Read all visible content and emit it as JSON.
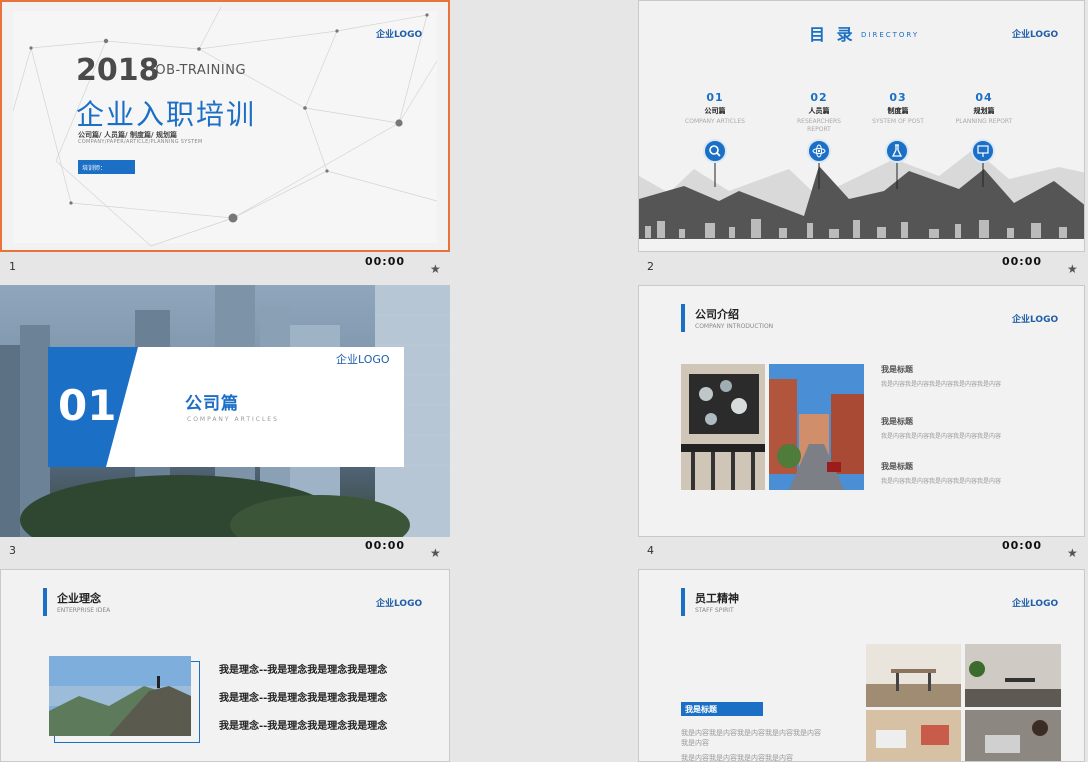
{
  "slides": [
    {
      "number": "1",
      "time": "00:00",
      "logo": "企业LOGO",
      "year": "2018",
      "job_training": "JOB-TRAINING",
      "title": "企业入职培训",
      "subtitle": "公司篇/ 人员篇/ 制度篇/ 规划篇",
      "subtitle_en": "COMPANY/PAPER/ARTICLE/PLANNING SYSTEM",
      "trainer": "培训师："
    },
    {
      "number": "2",
      "time": "00:00",
      "logo": "企业LOGO",
      "title": "目 录",
      "title_en": "DIRECTORY",
      "items": [
        {
          "num": "01",
          "label": "公司篇",
          "en": "COMPANY ARTICLES",
          "icon": "search-icon"
        },
        {
          "num": "02",
          "label": "人员篇",
          "en": "RESEARCHERS REPORT",
          "icon": "atom-icon"
        },
        {
          "num": "03",
          "label": "制度篇",
          "en": "SYSTEM OF POST",
          "icon": "flask-icon"
        },
        {
          "num": "04",
          "label": "规划篇",
          "en": "PLANNING REPORT",
          "icon": "presentation-icon"
        }
      ]
    },
    {
      "number": "3",
      "time": "00:00",
      "logo": "企业LOGO",
      "section_num": "01",
      "title": "公司篇",
      "title_en": "COMPANY ARTICLES"
    },
    {
      "number": "4",
      "time": "00:00",
      "logo": "企业LOGO",
      "title": "公司介绍",
      "title_en": "COMPANY INTRODUCTION",
      "blocks": [
        {
          "heading": "我是标题",
          "text": "我是内容我是内容我是内容我是内容我是内容"
        },
        {
          "heading": "我是标题",
          "text": "我是内容我是内容我是内容我是内容我是内容"
        },
        {
          "heading": "我是标题",
          "text": "我是内容我是内容我是内容我是内容我是内容"
        }
      ]
    },
    {
      "number": "",
      "time": "",
      "logo": "企业LOGO",
      "title": "企业理念",
      "title_en": "ENTERPRISE IDEA",
      "lines": [
        "我是理念--我是理念我是理念我是理念",
        "我是理念--我是理念我是理念我是理念",
        "我是理念--我是理念我是理念我是理念"
      ]
    },
    {
      "number": "",
      "time": "",
      "logo": "企业LOGO",
      "title": "员工精神",
      "title_en": "STAFF SPIRIT",
      "tag": "我是标题",
      "text1": "我是内容我是内容我是内容我是内容我是内容我是内容",
      "text2": "我是内容我是内容我是内容我是内容"
    }
  ],
  "colors": {
    "accent": "#1b6fc4",
    "selection": "#e8743b"
  }
}
